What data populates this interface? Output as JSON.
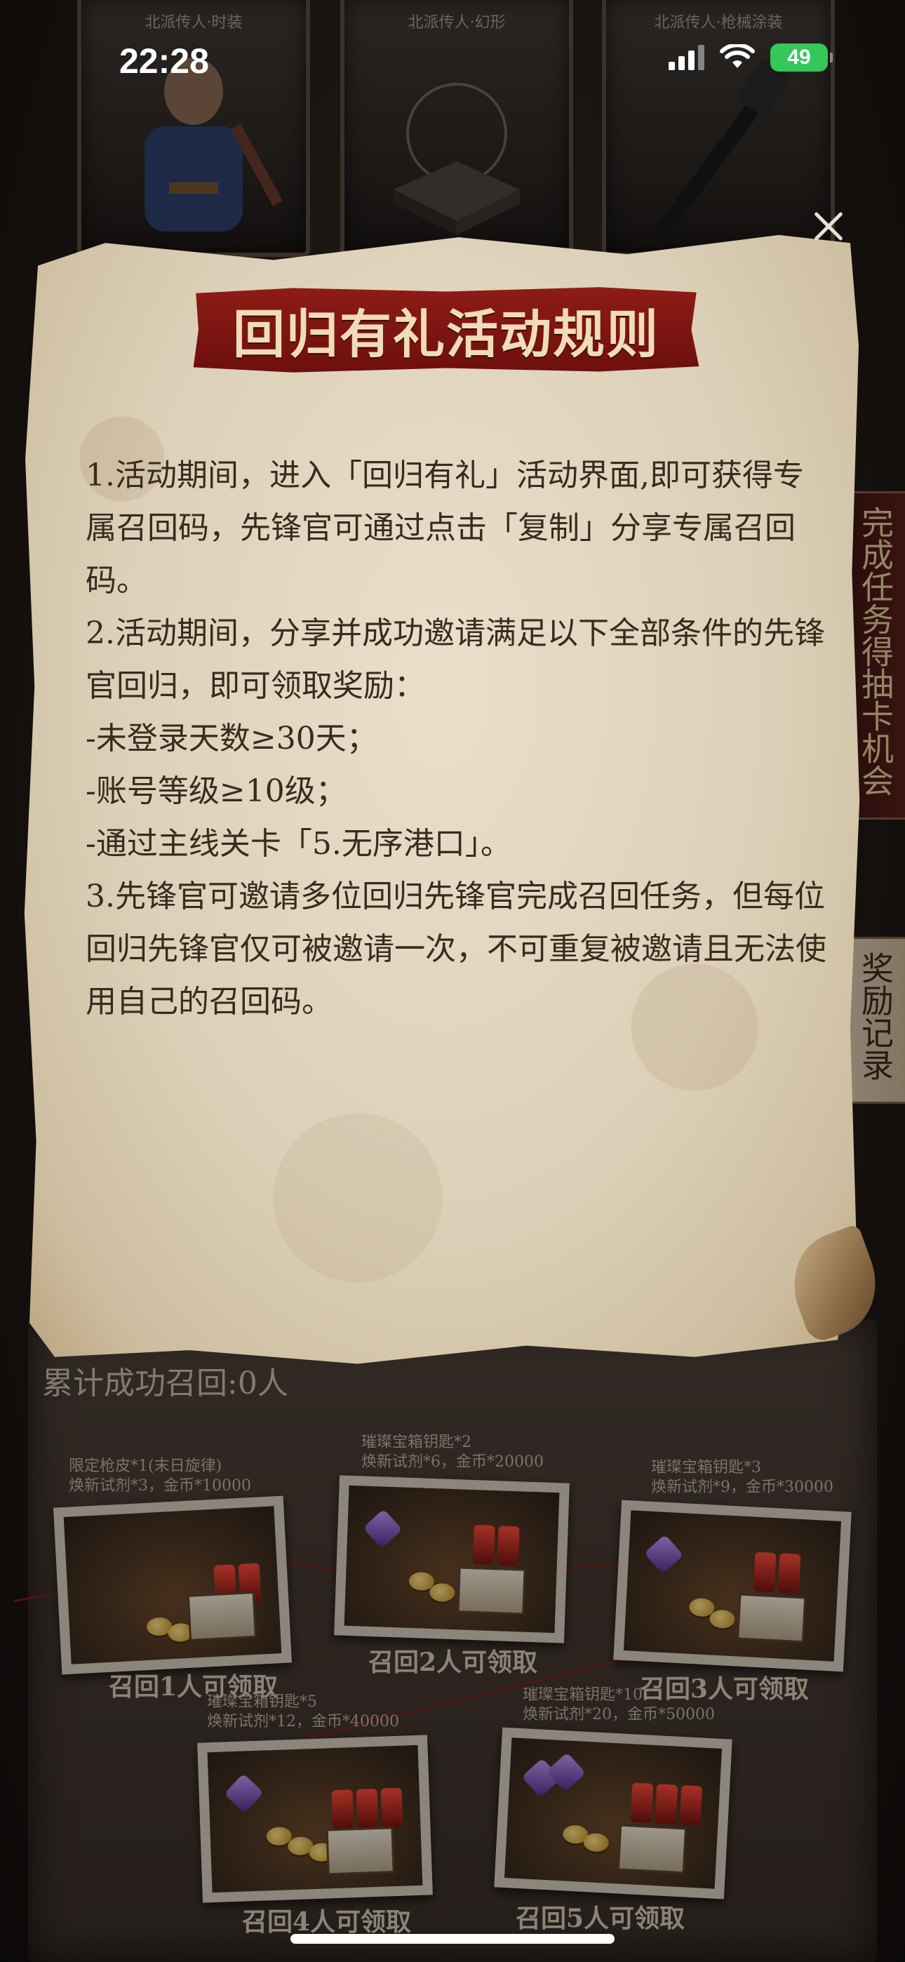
{
  "status_bar": {
    "time": "22:28",
    "battery": "49"
  },
  "top_cards": [
    {
      "caption": "北派传人·时装"
    },
    {
      "caption": "北派传人·幻形"
    },
    {
      "caption": "北派传人·枪械涂装"
    }
  ],
  "side_tabs": {
    "tasks": "完成任务得抽卡机会",
    "records": "奖励记录"
  },
  "dialog": {
    "title": "回归有礼活动规则",
    "rules": [
      "1.活动期间，进入「回归有礼」活动界面,即可获得专属召回码，先锋官可通过点击「复制」分享专属召回码。",
      "2.活动期间，分享并成功邀请满足以下全部条件的先锋官回归，即可领取奖励：",
      "-未登录天数≥30天；",
      "-账号等级≥10级；",
      "-通过主线关卡「5.无序港口」。",
      "3.先锋官可邀请多位回归先锋官完成召回任务，但每位回归先锋官仅可被邀请一次，不可重复被邀请且无法使用自己的召回码。"
    ]
  },
  "rewards_board": {
    "count_title": "累计成功召回:0人",
    "rewards": [
      {
        "desc1": "限定枪皮*1(末日旋律)",
        "desc2": "焕新试剂*3，金币*10000",
        "claim": "召回1人可领取"
      },
      {
        "desc1": "璀璨宝箱钥匙*2",
        "desc2": "焕新试剂*6，金币*20000",
        "claim": "召回2人可领取"
      },
      {
        "desc1": "璀璨宝箱钥匙*3",
        "desc2": "焕新试剂*9，金币*30000",
        "claim": "召回3人可领取"
      },
      {
        "desc1": "璀璨宝箱钥匙*5",
        "desc2": "焕新试剂*12，金币*40000",
        "claim": "召回4人可领取"
      },
      {
        "desc1": "璀璨宝箱钥匙*10",
        "desc2": "焕新试剂*20，金币*50000",
        "claim": "召回5人可领取"
      }
    ]
  },
  "colors": {
    "banner_red": "#7d1613",
    "parchment": "#e2d6c0",
    "text": "#3b2a1f"
  }
}
